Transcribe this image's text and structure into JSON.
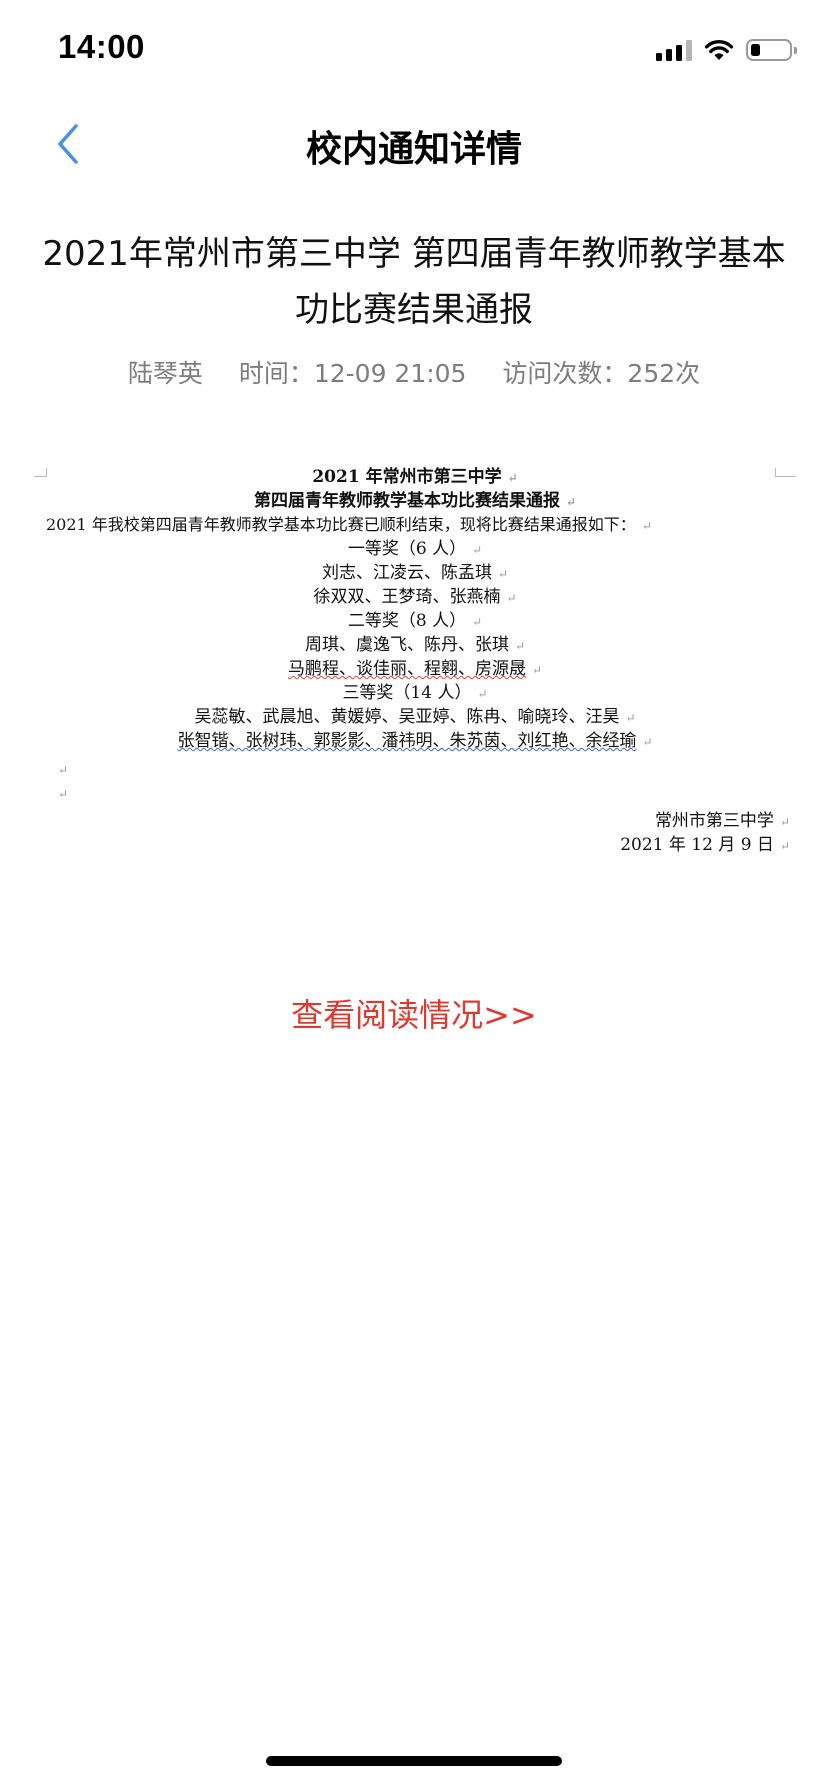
{
  "status_bar": {
    "time": "14:00",
    "battery_level": 0.25,
    "icons": [
      "signal-icon",
      "wifi-icon",
      "battery-icon"
    ]
  },
  "nav": {
    "back_icon": "chevron-left-icon",
    "title": "校内通知详情",
    "accent_color": "#4a90e2"
  },
  "article": {
    "title": "2021年常州市第三中学 第四届青年教师教学基本功比赛结果通报",
    "author": "陆琴英",
    "time": "时间：12-09  21:05",
    "visits": "访问次数：252次"
  },
  "document": {
    "school_line": "2021 年常州市第三中学",
    "title_line": "第四届青年教师教学基本功比赛结果通报",
    "intro": "2021 年我校第四届青年教师教学基本功比赛已顺利结束，现将比赛结果通报如下：",
    "first_prize": {
      "heading": "一等奖（6 人）",
      "lines": [
        "刘志、江凌云、陈孟琪",
        "徐双双、王梦琦、张燕楠"
      ]
    },
    "second_prize": {
      "heading": "二等奖（8 人）",
      "lines": [
        "周琪、虞逸飞、陈丹、张琪",
        "马鹏程、谈佳丽、程翱、房源晟"
      ]
    },
    "third_prize": {
      "heading": "三等奖（14 人）",
      "lines": [
        "吴蕊敏、武晨旭、黄媛婷、吴亚婷、陈冉、喻晓玲、汪昊",
        "张智锴、张树玮、郭影影、潘祎明、朱苏茵、刘红艳、余经瑜"
      ]
    },
    "signature": "常州市第三中学",
    "date": "2021 年 12 月 9 日"
  },
  "read_status": {
    "label": "查看阅读情况>>",
    "color": "#e0382f"
  }
}
